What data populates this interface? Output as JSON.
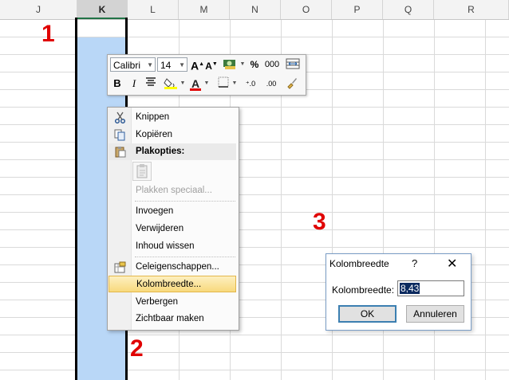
{
  "columns": [
    "J",
    "K",
    "L",
    "M",
    "N",
    "O",
    "P",
    "Q",
    "R"
  ],
  "selected_column": "K",
  "annotations": [
    "1",
    "2",
    "3"
  ],
  "annotation_color": "#e00000",
  "selection_color": "#b9d7f7",
  "mini_toolbar": {
    "font": "Calibri",
    "size": "14",
    "grow_label": "A",
    "shrink_label": "A",
    "percent_label": "%",
    "thousands_label": "000",
    "bold_label": "B",
    "italic_label": "I",
    "font_color_label": "A",
    "inc_decimal_label": "⁺.0",
    "dec_decimal_label": ".00"
  },
  "context_menu": {
    "cut": "Knippen",
    "copy": "Kopiëren",
    "paste_options": "Plakopties:",
    "paste_special": "Plakken speciaal...",
    "insert": "Invoegen",
    "delete": "Verwijderen",
    "clear_contents": "Inhoud wissen",
    "cell_properties": "Celeigenschappen...",
    "column_width": "Kolombreedte...",
    "hide": "Verbergen",
    "unhide": "Zichtbaar maken",
    "highlight_color": "#f8d97d"
  },
  "dialog": {
    "title": "Kolombreedte",
    "help": "?",
    "close": "✕",
    "field_label": "Kolombreedte:",
    "field_value": "8,43",
    "ok": "OK",
    "cancel": "Annuleren"
  }
}
